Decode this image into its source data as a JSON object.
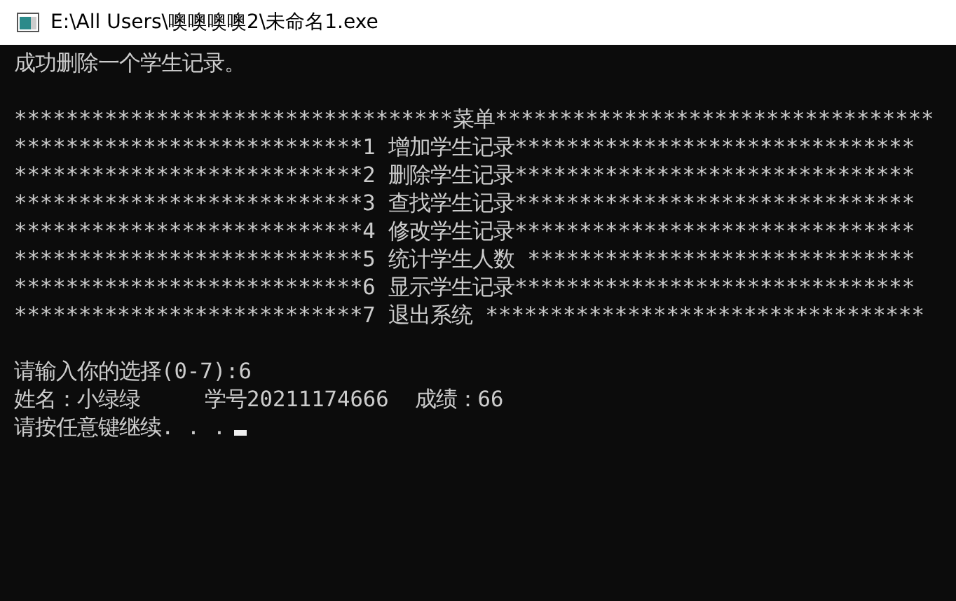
{
  "window": {
    "title": "E:\\All Users\\噢噢噢噢2\\未命名1.exe"
  },
  "console": {
    "message": "成功删除一个学生记录。",
    "menu": [
      "**********************************菜单**********************************",
      "***************************1 增加学生记录*******************************",
      "***************************2 删除学生记录*******************************",
      "***************************3 查找学生记录*******************************",
      "***************************4 修改学生记录*******************************",
      "***************************5 统计学生人数 ******************************",
      "***************************6 显示学生记录*******************************",
      "***************************7 退出系统 **********************************"
    ],
    "output": [
      "请输入你的选择(0-7):6",
      "姓名：小绿绿     学号20211174666  成绩：66",
      "请按任意键继续. . ."
    ]
  }
}
